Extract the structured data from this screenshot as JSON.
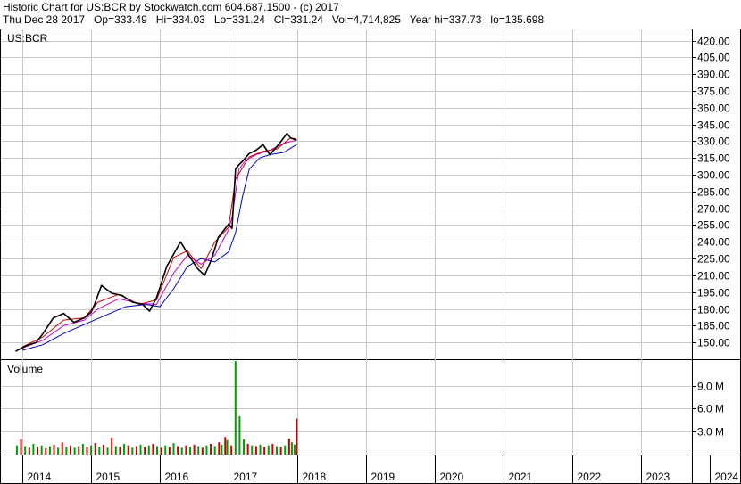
{
  "header": {
    "line1": "Historic Chart for US:BCR by Stockwatch.com 604.687.1500 - (c) 2017",
    "line2": "Thu Dec 28 2017   Op=333.49   Hi=334.03   Lo=331.24   Cl=331.24   Vol=4,714,825   Year hi=337.73   lo=135.698"
  },
  "colors": {
    "price": "#000000",
    "ma_short": "#cc0000",
    "ma_mid": "#cc00cc",
    "ma_long": "#0000cc",
    "vol_up": "#00a000",
    "vol_down": "#cc0000",
    "grid": "#c8c8c8"
  },
  "chart_data": [
    {
      "type": "line",
      "title": "US:BCR",
      "ylim": [
        135,
        430
      ],
      "y_ticks": [
        "420.00",
        "405.00",
        "390.00",
        "375.00",
        "360.00",
        "345.00",
        "330.00",
        "315.00",
        "300.00",
        "285.00",
        "270.00",
        "255.00",
        "240.00",
        "225.00",
        "210.00",
        "195.00",
        "180.00",
        "165.00",
        "150.00"
      ],
      "x_ticks": [
        "2014",
        "2015",
        "2016",
        "2017",
        "2018",
        "2019",
        "2020",
        "2021",
        "2022",
        "2023",
        "2024"
      ],
      "series": [
        {
          "key": "price",
          "x": [
            2013.9,
            2014.05,
            2014.2,
            2014.3,
            2014.45,
            2014.6,
            2014.75,
            2014.9,
            2015.0,
            2015.05,
            2015.15,
            2015.3,
            2015.45,
            2015.6,
            2015.75,
            2015.85,
            2015.95,
            2016.0,
            2016.1,
            2016.2,
            2016.3,
            2016.4,
            2016.45,
            2016.55,
            2016.65,
            2016.75,
            2016.85,
            2016.95,
            2017.0,
            2017.05,
            2017.1,
            2017.15,
            2017.2,
            2017.3,
            2017.4,
            2017.5,
            2017.6,
            2017.7,
            2017.8,
            2017.85,
            2017.9,
            2017.99
          ],
          "values": [
            142,
            147,
            150,
            158,
            172,
            176,
            168,
            172,
            177,
            184,
            201,
            194,
            192,
            186,
            184,
            178,
            190,
            199,
            218,
            229,
            240,
            230,
            225,
            216,
            210,
            224,
            244,
            252,
            256,
            252,
            305,
            309,
            312,
            319,
            322,
            327,
            318,
            325,
            333,
            337,
            333,
            331
          ]
        },
        {
          "key": "ma_short",
          "x": [
            2014.0,
            2014.3,
            2014.6,
            2014.9,
            2015.1,
            2015.4,
            2015.7,
            2015.95,
            2016.2,
            2016.4,
            2016.6,
            2016.8,
            2017.0,
            2017.1,
            2017.3,
            2017.5,
            2017.7,
            2017.9,
            2017.99
          ],
          "values": [
            146,
            155,
            170,
            172,
            186,
            193,
            184,
            188,
            226,
            232,
            216,
            240,
            253,
            296,
            316,
            321,
            323,
            333,
            332
          ]
        },
        {
          "key": "ma_mid",
          "x": [
            2014.0,
            2014.3,
            2014.6,
            2014.9,
            2015.1,
            2015.4,
            2015.7,
            2015.95,
            2016.2,
            2016.4,
            2016.6,
            2016.8,
            2017.0,
            2017.05,
            2017.15,
            2017.25,
            2017.4,
            2017.6,
            2017.8,
            2017.99
          ],
          "values": [
            145,
            152,
            165,
            170,
            180,
            189,
            185,
            184,
            212,
            228,
            220,
            228,
            251,
            262,
            305,
            313,
            318,
            322,
            328,
            331
          ]
        },
        {
          "key": "ma_long",
          "x": [
            2014.0,
            2014.3,
            2014.6,
            2014.9,
            2015.2,
            2015.5,
            2015.8,
            2016.0,
            2016.2,
            2016.4,
            2016.6,
            2016.8,
            2017.0,
            2017.1,
            2017.2,
            2017.3,
            2017.45,
            2017.6,
            2017.8,
            2017.99
          ],
          "values": [
            143,
            148,
            158,
            166,
            174,
            182,
            184,
            182,
            198,
            218,
            225,
            222,
            231,
            248,
            280,
            305,
            315,
            318,
            320,
            327
          ]
        }
      ]
    },
    {
      "type": "bar",
      "title": "Volume",
      "ylim": [
        0,
        12.5
      ],
      "y_ticks": [
        "9.0 M",
        "6.0 M",
        "3.0 M"
      ],
      "x": [
        2013.92,
        2013.98,
        2014.04,
        2014.1,
        2014.16,
        2014.22,
        2014.28,
        2014.34,
        2014.4,
        2014.46,
        2014.52,
        2014.58,
        2014.64,
        2014.7,
        2014.76,
        2014.82,
        2014.88,
        2014.94,
        2015.0,
        2015.06,
        2015.12,
        2015.18,
        2015.24,
        2015.3,
        2015.36,
        2015.42,
        2015.48,
        2015.54,
        2015.6,
        2015.66,
        2015.72,
        2015.78,
        2015.84,
        2015.9,
        2015.96,
        2016.02,
        2016.08,
        2016.14,
        2016.2,
        2016.26,
        2016.32,
        2016.38,
        2016.44,
        2016.5,
        2016.56,
        2016.62,
        2016.68,
        2016.74,
        2016.8,
        2016.86,
        2016.9,
        2016.95,
        2016.98,
        2017.04,
        2017.1,
        2017.16,
        2017.22,
        2017.28,
        2017.34,
        2017.4,
        2017.46,
        2017.52,
        2017.58,
        2017.64,
        2017.7,
        2017.76,
        2017.82,
        2017.88,
        2017.92,
        2017.96,
        2017.99
      ],
      "values": [
        1.2,
        2.0,
        1.1,
        0.9,
        1.4,
        1.0,
        1.2,
        0.8,
        1.1,
        1.3,
        0.9,
        1.6,
        1.0,
        1.2,
        0.9,
        1.1,
        1.4,
        1.0,
        1.2,
        1.5,
        1.0,
        1.3,
        0.9,
        2.2,
        1.1,
        1.0,
        1.4,
        1.2,
        0.9,
        1.1,
        1.3,
        1.0,
        1.2,
        1.4,
        1.1,
        0.9,
        1.2,
        1.0,
        1.5,
        1.1,
        0.9,
        1.2,
        1.0,
        1.3,
        1.1,
        0.9,
        1.2,
        1.4,
        1.1,
        1.6,
        1.3,
        2.3,
        1.9,
        1.2,
        12.2,
        5.0,
        2.0,
        1.4,
        1.2,
        1.1,
        1.3,
        1.0,
        1.2,
        1.4,
        1.1,
        1.0,
        1.2,
        2.1,
        1.6,
        1.3,
        4.7
      ],
      "up": [
        true,
        false,
        true,
        false,
        true,
        false,
        true,
        false,
        true,
        false,
        true,
        false,
        true,
        false,
        true,
        false,
        true,
        false,
        true,
        false,
        true,
        false,
        true,
        false,
        true,
        false,
        true,
        false,
        true,
        false,
        true,
        false,
        true,
        false,
        true,
        false,
        true,
        false,
        true,
        false,
        true,
        false,
        true,
        false,
        true,
        false,
        true,
        false,
        true,
        false,
        true,
        false,
        true,
        false,
        true,
        true,
        true,
        false,
        true,
        false,
        true,
        false,
        true,
        false,
        true,
        false,
        true,
        false,
        true,
        true,
        false
      ]
    }
  ]
}
